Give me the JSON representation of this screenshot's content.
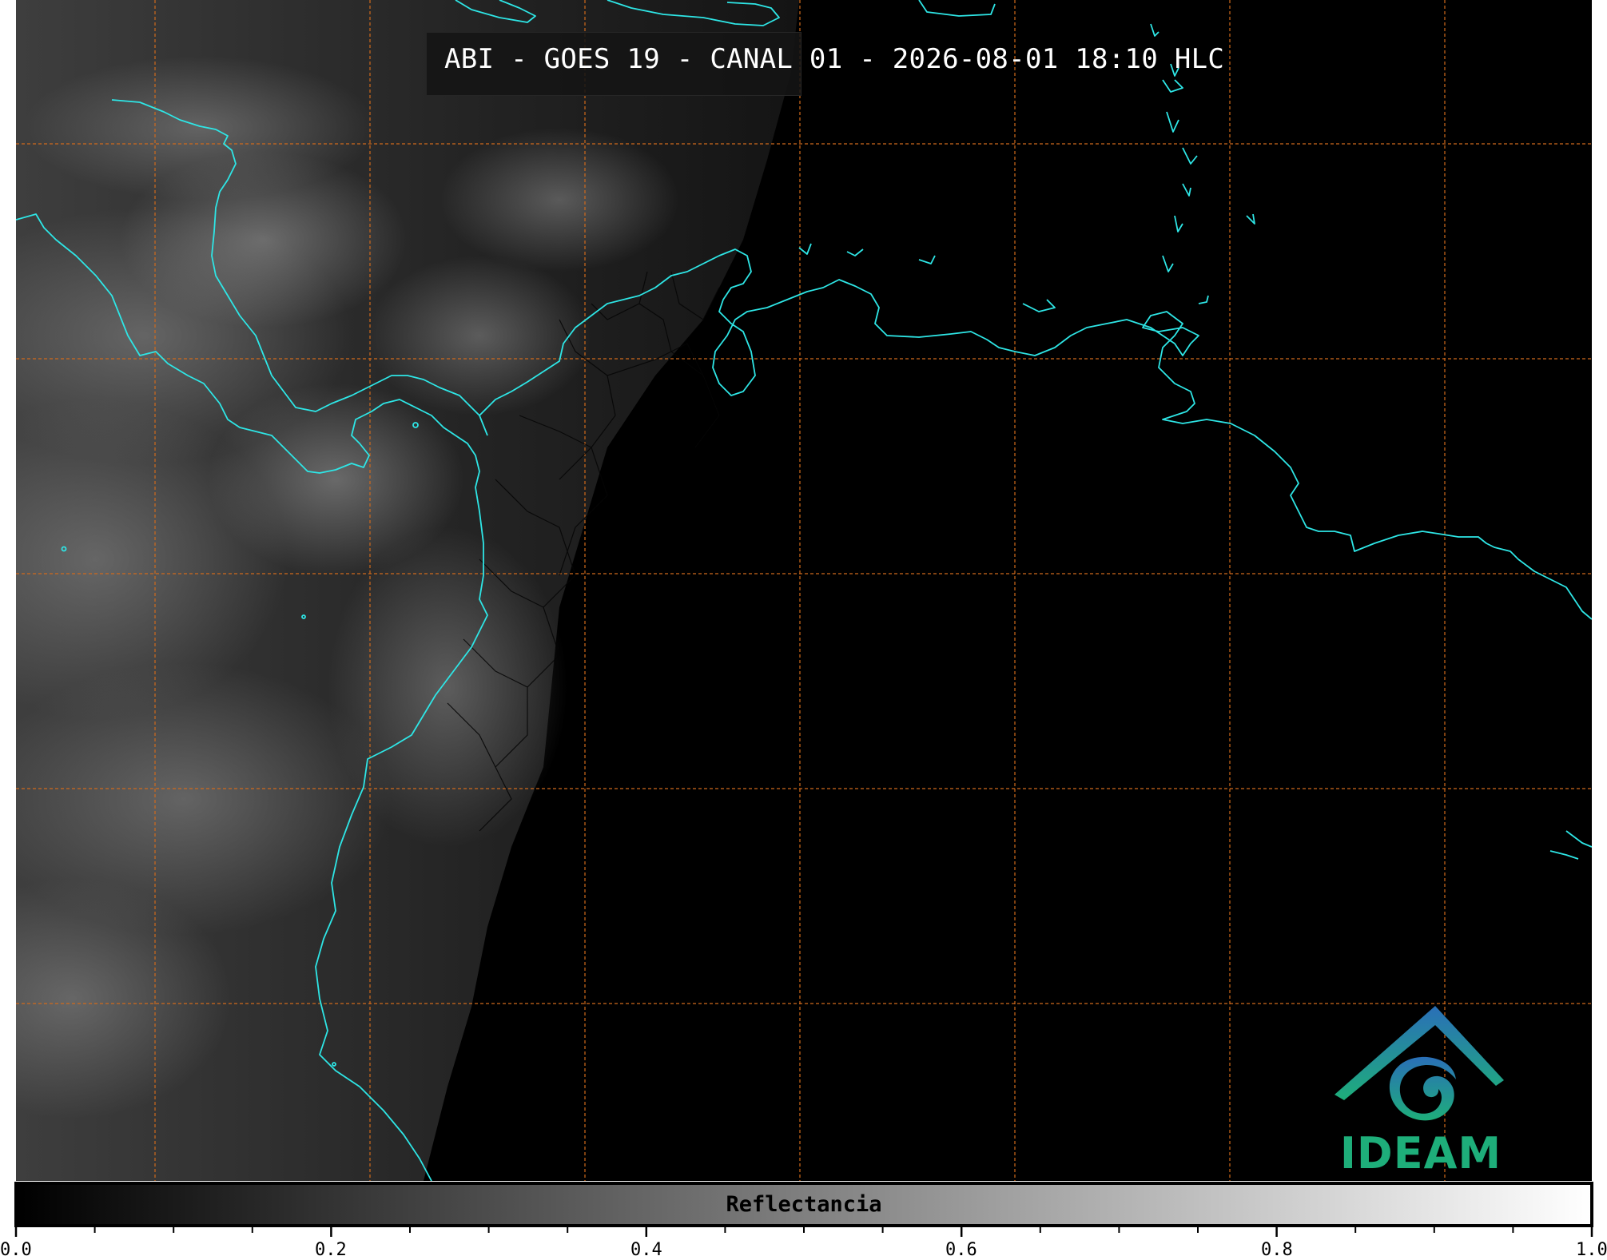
{
  "map": {
    "title": "ABI - GOES 19 - CANAL 01 - 2026-08-01 18:10 HLC",
    "coastline_color": "#2ee6e6",
    "grid_color": "#d06a1c",
    "background_color": "#000000"
  },
  "logo": {
    "text": "IDEAM",
    "text_color": "#1eae7a",
    "accent_color": "#2a8fb8"
  },
  "colorbar": {
    "label": "Reflectancia",
    "min": 0.0,
    "max": 1.0,
    "major_ticks": [
      "0.0",
      "0.2",
      "0.4",
      "0.6",
      "0.8",
      "1.0"
    ],
    "minor_tick_step": 0.05,
    "colormap": "grayscale"
  }
}
